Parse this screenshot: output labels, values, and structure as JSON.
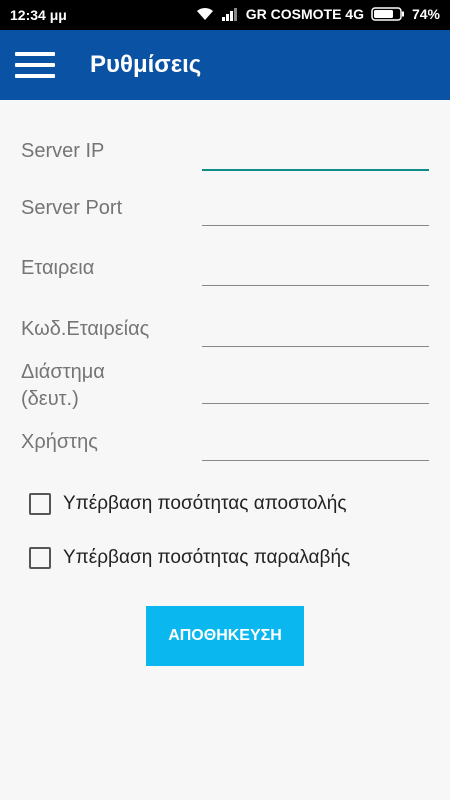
{
  "status_bar": {
    "time": "12:34 μμ",
    "carrier": "GR COSMOTE 4G",
    "battery": "74%",
    "icons": [
      "wifi-icon",
      "signal-icon",
      "battery-icon"
    ]
  },
  "app_bar": {
    "title": "Ρυθμίσεις",
    "menu_icon": "hamburger-menu-icon",
    "color": "#0a52a3"
  },
  "form": {
    "server_ip": {
      "label": "Server IP",
      "value": ""
    },
    "server_port": {
      "label": "Server Port",
      "value": ""
    },
    "company": {
      "label": "Εταιρεια",
      "value": ""
    },
    "company_code": {
      "label": "Κωδ.Εταιρείας",
      "value": ""
    },
    "interval": {
      "label_line1": "Διάστημα",
      "label_line2": "(δευτ.)",
      "value": ""
    },
    "user": {
      "label": "Χρήστης",
      "value": ""
    }
  },
  "checkboxes": [
    {
      "label": "Υπέρβαση ποσότητας αποστολής",
      "checked": false
    },
    {
      "label": "Υπέρβαση ποσότητας παραλαβής",
      "checked": false
    }
  ],
  "save_button": {
    "label": "ΑΠΟΘΗΚΕΥΣΗ",
    "color": "#0ab8ef"
  },
  "accent_color": "#0f8c86"
}
